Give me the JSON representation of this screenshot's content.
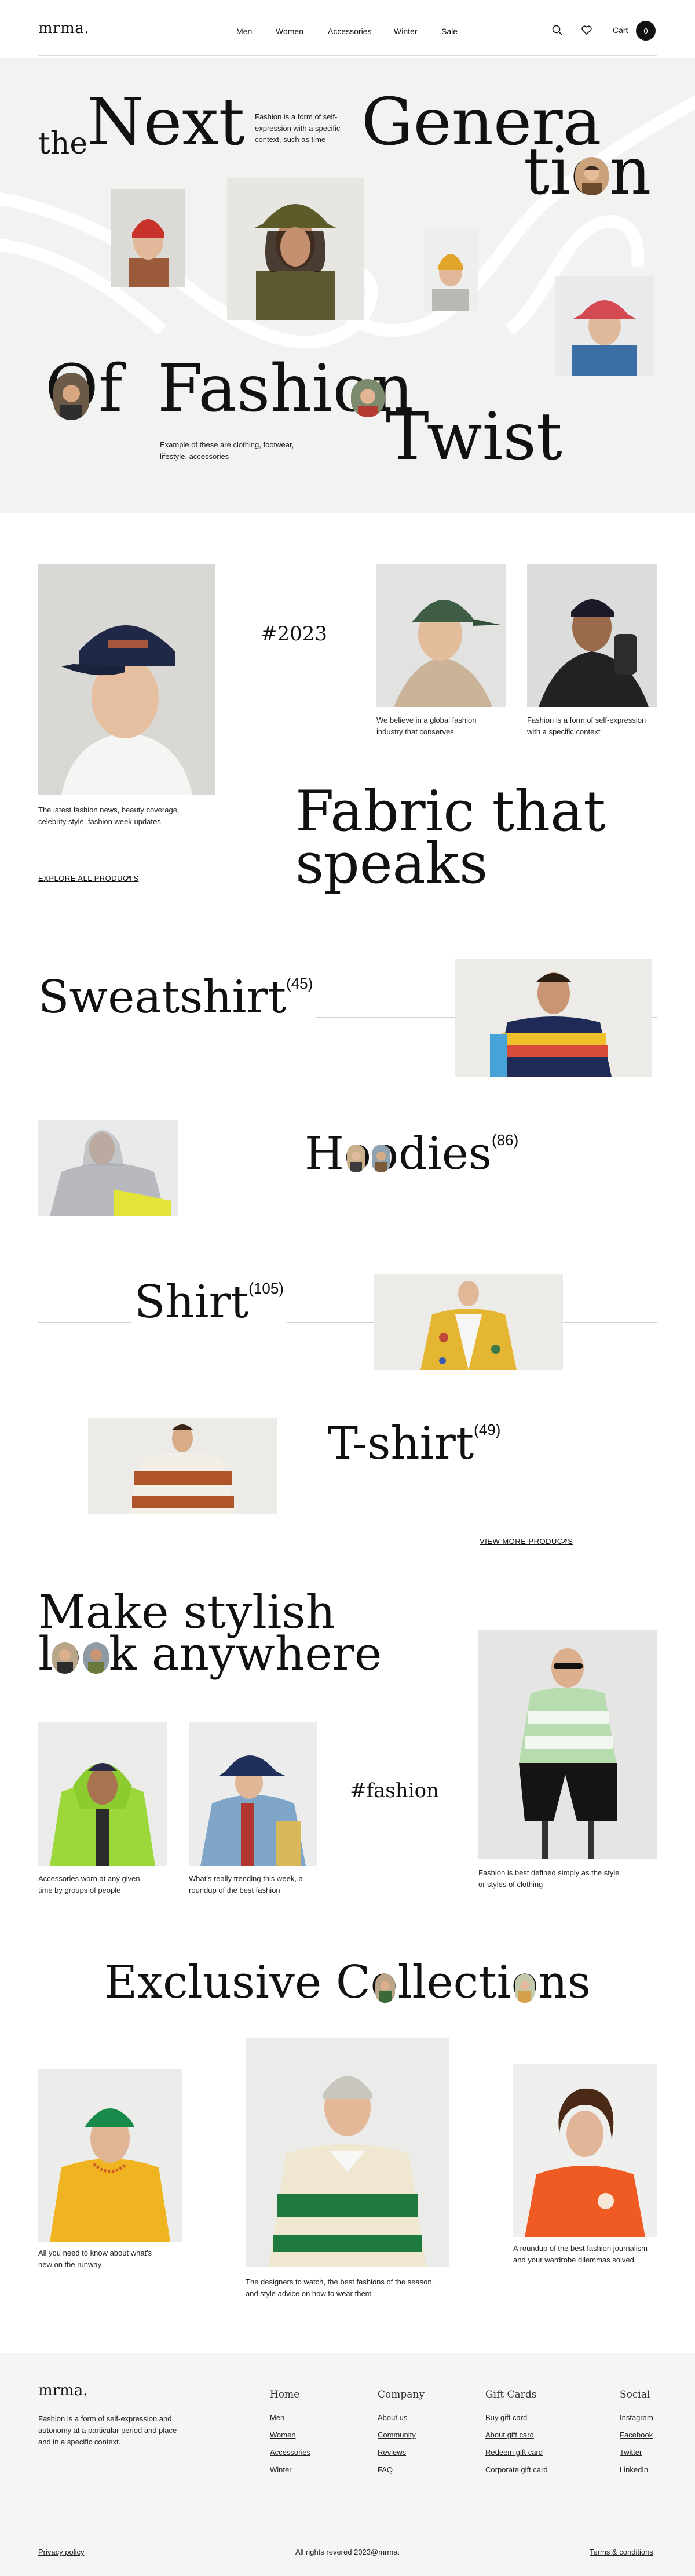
{
  "header": {
    "logo": "mrma.",
    "nav": [
      "Men",
      "Women",
      "Accessories",
      "Winter",
      "Sale"
    ],
    "cart_label": "Cart",
    "cart_count": "0"
  },
  "hero": {
    "word_the": "the",
    "word_next": "Next",
    "word_genera": "Genera",
    "word_tion": "tion",
    "word_of": "Of",
    "word_fashion": "Fashion",
    "word_twist": "Twist",
    "desc_top": "Fashion is a form of self-expression with a specific context, such as time",
    "desc_bottom": "Example of these are clothing, footwear, lifestyle, accessories"
  },
  "intro": {
    "year": "#2023",
    "caption_cap": "The latest fashion news, beauty coverage, celebrity style, fashion week updates",
    "explore": "EXPLORE ALL PRODUCTS",
    "caption_mid": "We believe in a global fashion industry that conserves",
    "caption_right": "Fashion is a form of self-expression with a specific context",
    "headline_1": "Fabric that",
    "headline_2": "speaks"
  },
  "categories": [
    {
      "name": "Sweatshirt",
      "count": "(45)"
    },
    {
      "name": "Hoodies",
      "count": "(86)"
    },
    {
      "name": "Shirt",
      "count": "(105)"
    },
    {
      "name": "T-shirt",
      "count": "(49)"
    }
  ],
  "view_more": "VIEW MORE PRODUCTS",
  "stylish": {
    "line1": "Make stylish",
    "line2": "look anywhere",
    "tag": "#fashion",
    "cap1": "Accessories worn at any given time by groups of people",
    "cap2": "What's really trending this week, a roundup of the best fashion",
    "cap3": "Fashion is best defined simply as the style or styles of clothing"
  },
  "exclusive": {
    "title": "Exclusive Collections",
    "cap1": "All you need to know about what's new on the runway",
    "cap2": "The designers to watch, the best fashions of the season, and style advice on how to wear them",
    "cap3": "A roundup of the best fashion journalism and your wardrobe dilemmas solved"
  },
  "footer": {
    "logo": "mrma.",
    "about": "Fashion is a form of self-expression and autonomy at a particular period and place and in a specific context.",
    "cols": [
      {
        "title": "Home",
        "items": [
          "Men",
          "Women",
          "Accessories",
          "Winter"
        ]
      },
      {
        "title": "Company",
        "items": [
          "About us",
          "Community",
          "Reviews",
          "FAQ"
        ]
      },
      {
        "title": "Gift Cards",
        "items": [
          "Buy gift card",
          "About gift card",
          "Redeem gift card",
          "Corporate gift card"
        ]
      },
      {
        "title": "Social",
        "items": [
          "Instagram",
          "Facebook",
          "Twitter",
          "LinkedIn"
        ]
      }
    ],
    "privacy": "Privacy policy",
    "rights": "All rights revered 2023@mrma.",
    "terms": "Terms & conditions"
  },
  "colors": {
    "bg": "#ffffff",
    "hero_bg": "#f2f2f0",
    "text": "#111111",
    "footer_bg": "#f5f5f5"
  }
}
